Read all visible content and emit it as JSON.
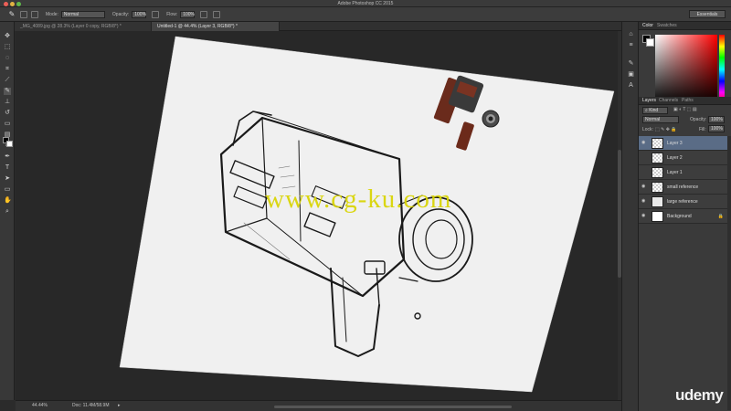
{
  "app": {
    "title": "Adobe Photoshop CC 2015",
    "workspace": "Essentials"
  },
  "options_bar": {
    "mode_label": "Mode:",
    "mode_value": "Normal",
    "opacity_label": "Opacity:",
    "opacity_value": "100%",
    "flow_label": "Flow:",
    "flow_value": "100%"
  },
  "doc_tabs": [
    {
      "label": "_MG_4089.jpg @ 28.3% (Layer 0 copy, RGB/8*) *"
    },
    {
      "label": "Untitled-1 @ 44.4% (Layer 3, RGB/8*) *"
    }
  ],
  "status": {
    "zoom": "44.44%",
    "doc": "Doc: 11.4M/58.9M"
  },
  "color_panel": {
    "tabs": [
      "Color",
      "Swatches"
    ]
  },
  "layers_panel": {
    "tabs": [
      "Layers",
      "Channels",
      "Paths"
    ],
    "filter": "Kind",
    "blend_mode": "Normal",
    "opacity_label": "Opacity:",
    "opacity_value": "100%",
    "lock_label": "Lock:",
    "fill_label": "Fill:",
    "fill_value": "100%",
    "layers": [
      {
        "name": "Layer 3"
      },
      {
        "name": "Layer 2"
      },
      {
        "name": "Layer 1"
      },
      {
        "name": "small reference"
      },
      {
        "name": "large reference"
      },
      {
        "name": "Background"
      }
    ]
  },
  "watermark": "www.cg-ku.com",
  "brand": "udemy"
}
